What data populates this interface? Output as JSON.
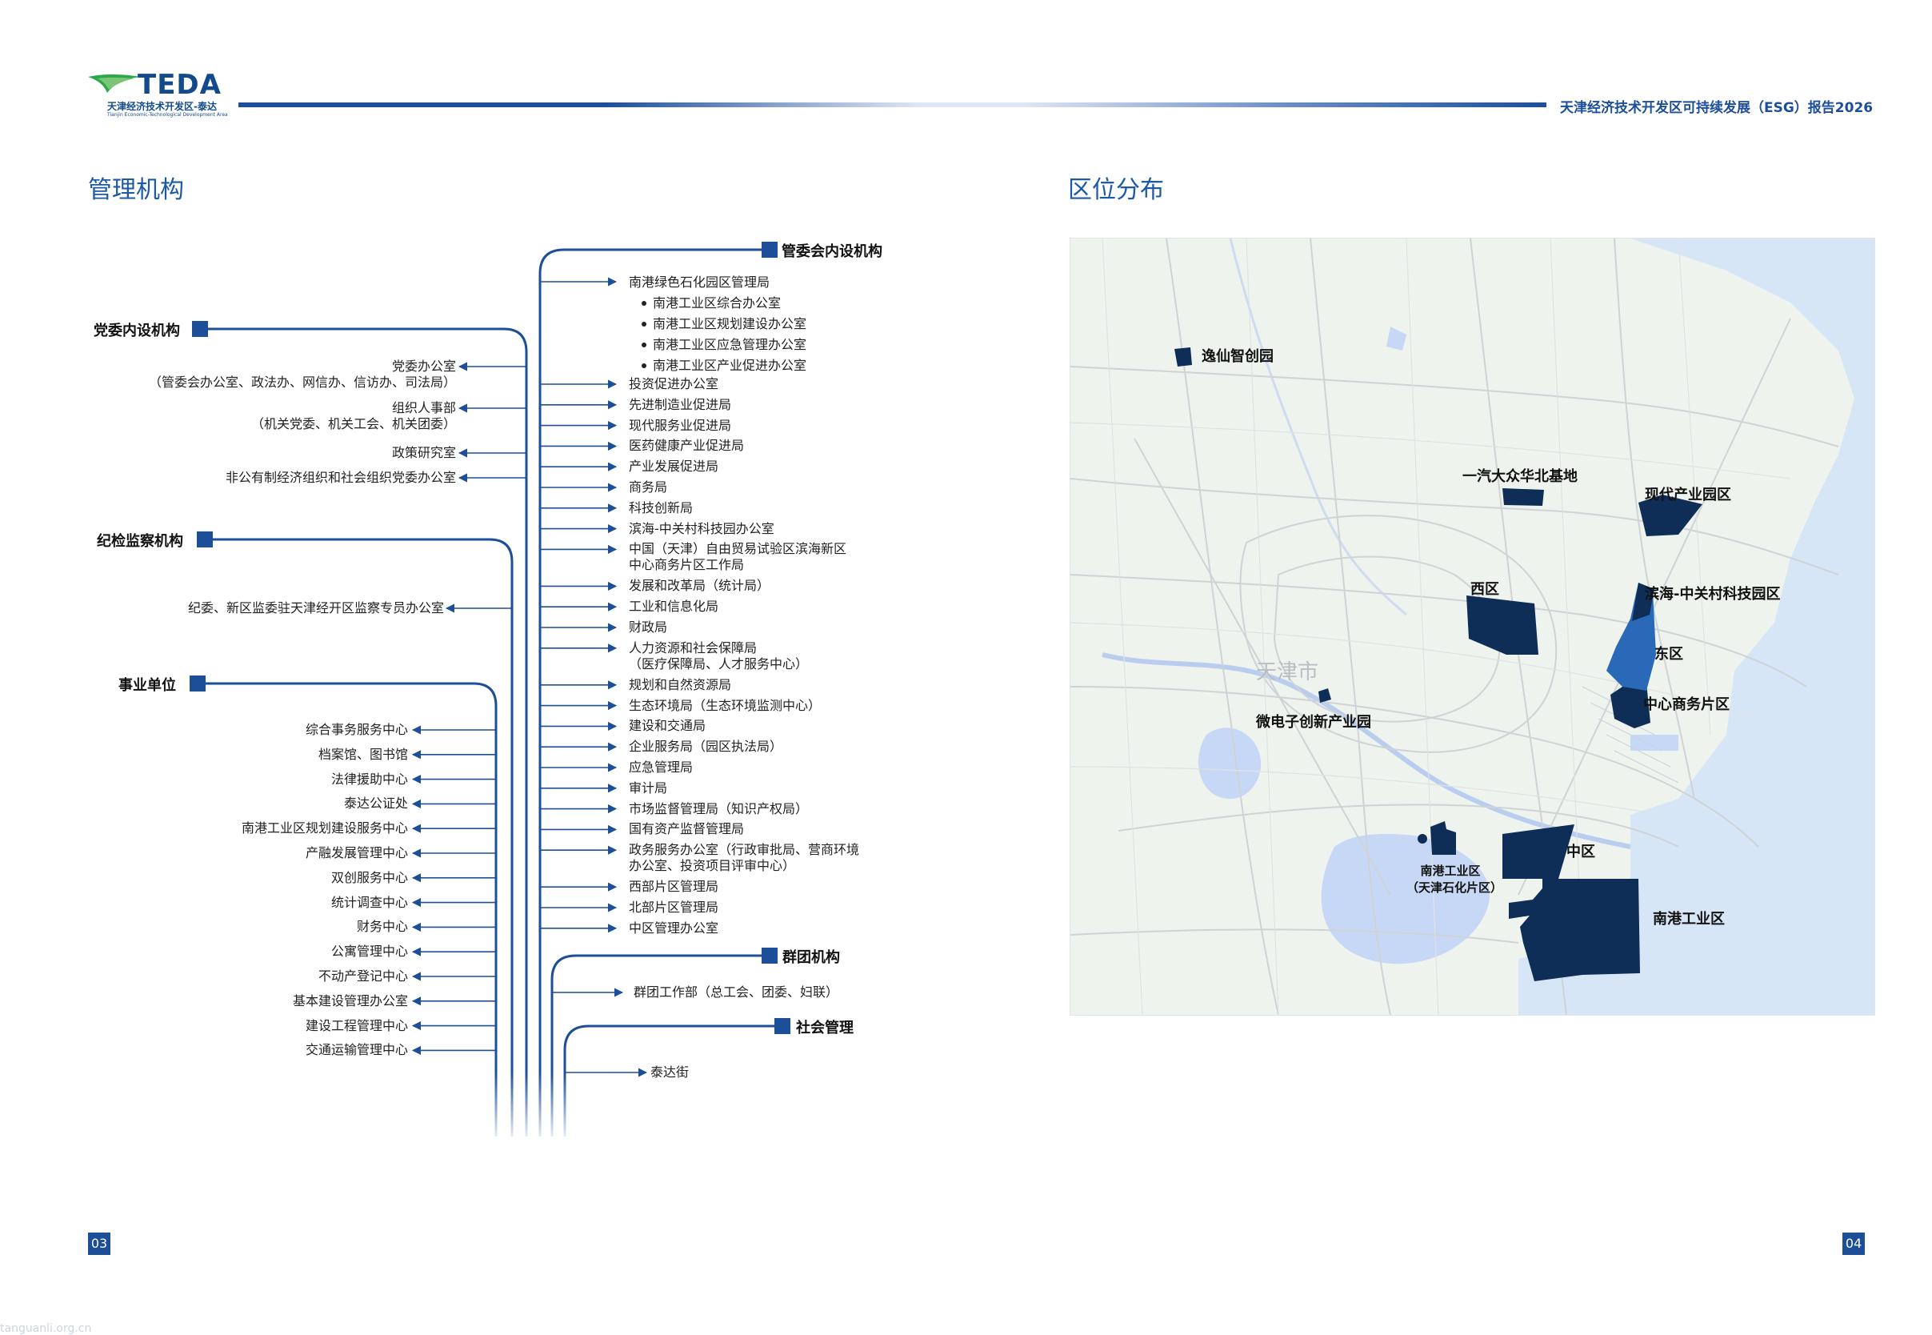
{
  "header": {
    "logo_word": "TEDA",
    "logo_cn": "天津经济技术开发区-泰达",
    "logo_en": "Tianjin Economic-Technological Development Area",
    "report_title": "天津经济技术开发区可持续发展（ESG）报告2026"
  },
  "left": {
    "title": "管理机构",
    "groups": {
      "party": "党委内设机构",
      "discipline": "纪检监察机构",
      "public": "事业单位",
      "committee": "管委会内设机构",
      "mass": "群团机构",
      "social": "社会管理"
    },
    "party_items": [
      {
        "l1": "党委办公室",
        "l2": "（管委会办公室、政法办、网信办、信访办、司法局）"
      },
      {
        "l1": "组织人事部",
        "l2": "（机关党委、机关工会、机关团委）"
      },
      {
        "l1": "政策研究室",
        "l2": ""
      },
      {
        "l1": "非公有制经济组织和社会组织党委办公室",
        "l2": ""
      }
    ],
    "discipline_items": [
      "纪委、新区监委驻天津经开区监察专员办公室"
    ],
    "public_items": [
      "综合事务服务中心",
      "档案馆、图书馆",
      "法律援助中心",
      "泰达公证处",
      "南港工业区规划建设服务中心",
      "产融发展管理中心",
      "双创服务中心",
      "统计调查中心",
      "财务中心",
      "公寓管理中心",
      "不动产登记中心",
      "基本建设管理办公室",
      "建设工程管理中心",
      "交通运输管理中心"
    ],
    "committee_first": "南港绿色石化园区管理局",
    "committee_sub": [
      "南港工业区综合办公室",
      "南港工业区规划建设办公室",
      "南港工业区应急管理办公室",
      "南港工业区产业促进办公室"
    ],
    "committee_items": [
      {
        "l1": "投资促进办公室",
        "l2": ""
      },
      {
        "l1": "先进制造业促进局",
        "l2": ""
      },
      {
        "l1": "现代服务业促进局",
        "l2": ""
      },
      {
        "l1": "医药健康产业促进局",
        "l2": ""
      },
      {
        "l1": "产业发展促进局",
        "l2": ""
      },
      {
        "l1": "商务局",
        "l2": ""
      },
      {
        "l1": "科技创新局",
        "l2": ""
      },
      {
        "l1": "滨海-中关村科技园办公室",
        "l2": ""
      },
      {
        "l1": "中国（天津）自由贸易试验区滨海新区",
        "l2": "中心商务片区工作局"
      },
      {
        "l1": "发展和改革局（统计局）",
        "l2": ""
      },
      {
        "l1": "工业和信息化局",
        "l2": ""
      },
      {
        "l1": "财政局",
        "l2": ""
      },
      {
        "l1": "人力资源和社会保障局",
        "l2": "（医疗保障局、人才服务中心）"
      },
      {
        "l1": "规划和自然资源局",
        "l2": ""
      },
      {
        "l1": "生态环境局（生态环境监测中心）",
        "l2": ""
      },
      {
        "l1": "建设和交通局",
        "l2": ""
      },
      {
        "l1": "企业服务局（园区执法局）",
        "l2": ""
      },
      {
        "l1": "应急管理局",
        "l2": ""
      },
      {
        "l1": "审计局",
        "l2": ""
      },
      {
        "l1": "市场监督管理局（知识产权局）",
        "l2": ""
      },
      {
        "l1": "国有资产监督管理局",
        "l2": ""
      },
      {
        "l1": "政务服务办公室（行政审批局、营商环境",
        "l2": "办公室、投资项目评审中心）"
      },
      {
        "l1": "西部片区管理局",
        "l2": ""
      },
      {
        "l1": "北部片区管理局",
        "l2": ""
      },
      {
        "l1": "中区管理办公室",
        "l2": ""
      }
    ],
    "mass_items": [
      "群团工作部（总工会、团委、妇联）"
    ],
    "social_items": [
      "泰达街"
    ]
  },
  "right": {
    "title": "区位分布",
    "map_labels": {
      "yixian": "逸仙智创园",
      "faw": "一汽大众华北基地",
      "modern": "现代产业园区",
      "west": "西区",
      "zgc": "滨海-中关村科技园区",
      "east": "东区",
      "cbd": "中心商务片区",
      "city": "天津市",
      "micro": "微电子创新产业园",
      "middle": "中区",
      "ngpetro1": "南港工业区",
      "ngpetro2": "（天津石化片区）",
      "nangang": "南港工业区"
    },
    "colors": {
      "zone": "#0e2d57",
      "zone_highlight": "#2a68b8",
      "sea": "#d6e6f6",
      "land": "#eef3ee"
    }
  },
  "footer": {
    "page_left": "03",
    "page_right": "04",
    "watermark": "tanguanli.org.cn"
  }
}
